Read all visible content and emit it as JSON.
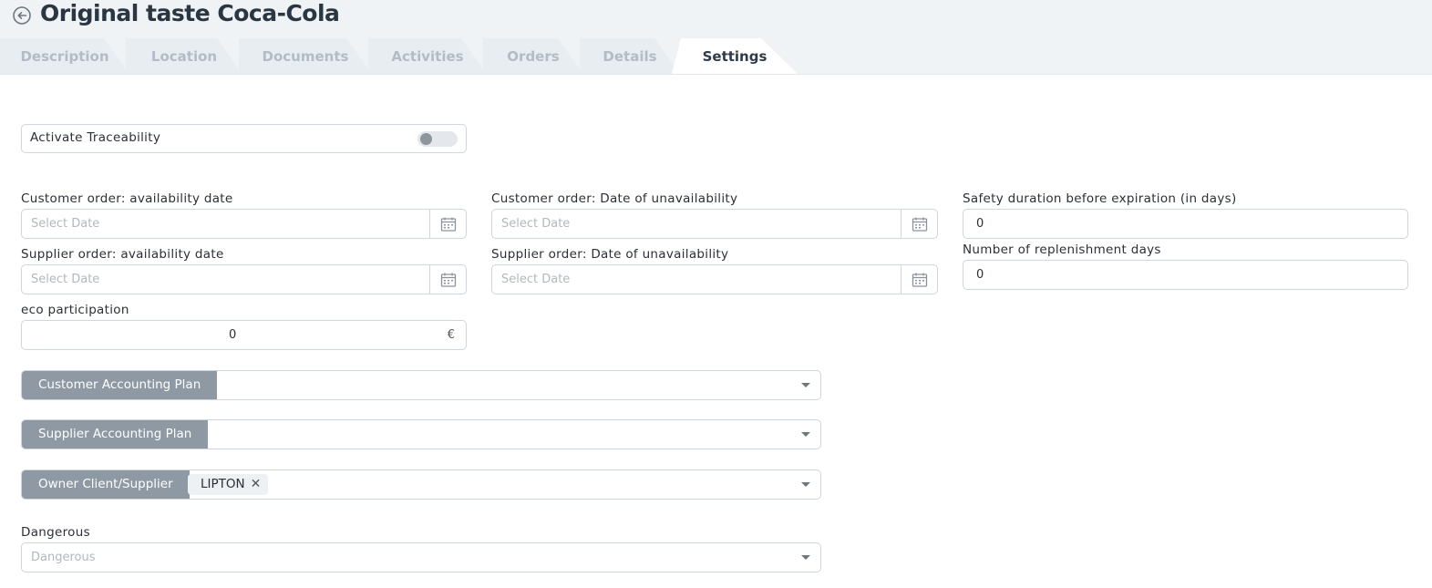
{
  "header": {
    "title": "Original taste Coca-Cola"
  },
  "tabs": [
    {
      "label": "Description"
    },
    {
      "label": "Location"
    },
    {
      "label": "Documents"
    },
    {
      "label": "Activities"
    },
    {
      "label": "Orders"
    },
    {
      "label": "Details"
    },
    {
      "label": "Settings",
      "active": true
    }
  ],
  "traceability": {
    "label": "Activate Traceability",
    "enabled": false
  },
  "fields": {
    "customer_avail": {
      "label": "Customer order: availability date",
      "placeholder": "Select Date"
    },
    "customer_unavail": {
      "label": "Customer order: Date of unavailability",
      "placeholder": "Select Date"
    },
    "safety_duration": {
      "label": "Safety duration before expiration (in days)",
      "value": "0"
    },
    "supplier_avail": {
      "label": "Supplier order: availability date",
      "placeholder": "Select Date"
    },
    "supplier_unavail": {
      "label": "Supplier order: Date of unavailability",
      "placeholder": "Select Date"
    },
    "replenishment": {
      "label": "Number of replenishment days",
      "value": "0"
    },
    "eco": {
      "label": "eco participation",
      "value": "0",
      "currency": "€"
    }
  },
  "selects": {
    "customer_plan": {
      "label": "Customer Accounting Plan"
    },
    "supplier_plan": {
      "label": "Supplier Accounting Plan"
    },
    "owner": {
      "label": "Owner Client/Supplier",
      "chip": "LIPTON"
    },
    "dangerous": {
      "label": "Dangerous",
      "placeholder": "Dangerous"
    }
  },
  "colors": {
    "accent_addon": "#8e99a3",
    "border": "#cfd6dd",
    "header_bg": "#eff3f6"
  }
}
